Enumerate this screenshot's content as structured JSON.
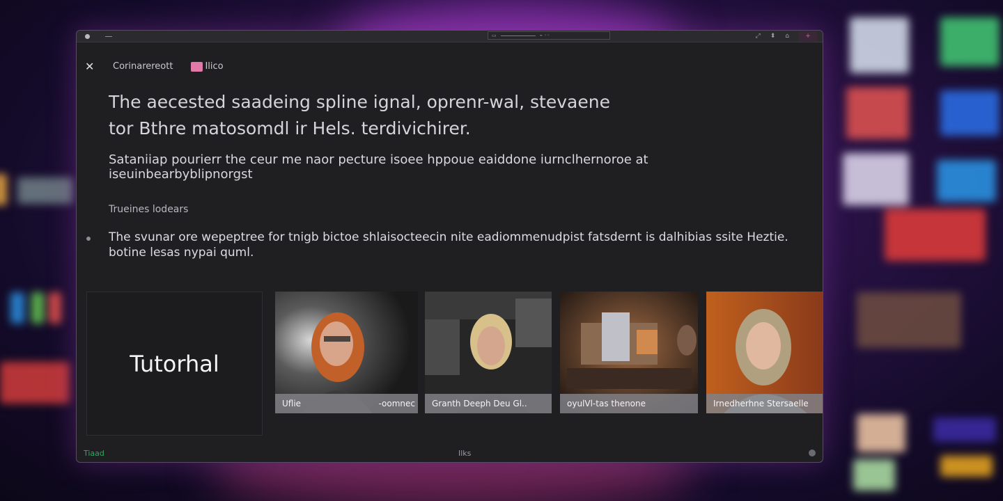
{
  "window": {
    "header": {
      "section_title": "Corinarereott",
      "tag_label": "Ilico"
    },
    "headline": "The aecested saadeing spline ignal, oprenr-wal, stevaene tor Bthre matosomdl ir Hels. terdivichirer.",
    "subline": "Sataniiap pourierr the ceur me naor pecture isoee hppoue eaiddone iurnclhernoroe at iseuinbearbyblipnorgst",
    "section_label": "Trueines lodears",
    "paragraph": "The svunar ore wepeptree for tnigb bictoe shlaisocteecin nite eadiommenudpist fatsdernt is dalhibias ssite Heztie. botine lesas nypai quml.",
    "tutorial_card": {
      "title": "Tutorhal"
    },
    "videos": [
      {
        "caption_left": "Uflie",
        "caption_right": "-oomnec"
      },
      {
        "caption_left": "Granth Deeph Deu Gl..",
        "caption_right": ""
      },
      {
        "caption_left": "oyulVl-tas thenone",
        "caption_right": ""
      },
      {
        "caption_left": "Irnedherhne Stersaelle",
        "caption_right": ""
      }
    ],
    "status": {
      "left_text": "Tiaad",
      "center_text": "Ilks"
    }
  },
  "colors": {
    "window_bg": "#1f1f21",
    "accent_pink": "#e07aa8",
    "status_green": "#2fa863"
  }
}
